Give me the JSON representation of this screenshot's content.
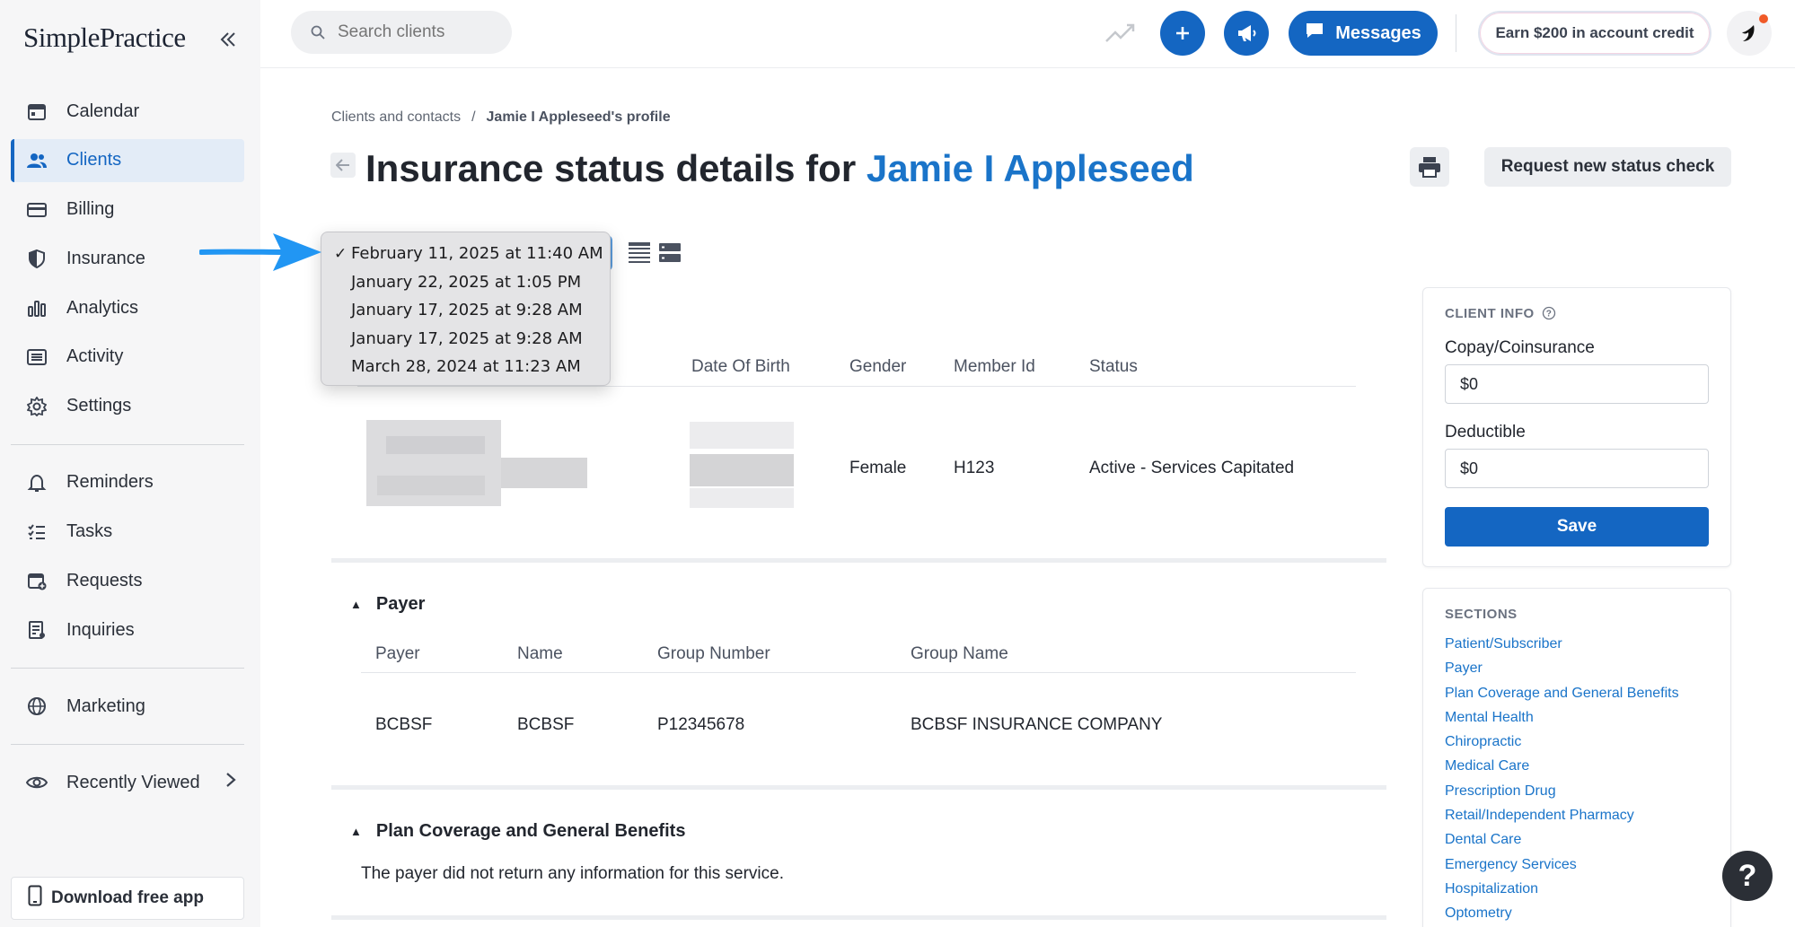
{
  "app": {
    "logo": "SimplePractice"
  },
  "sidebar": {
    "items": [
      {
        "label": "Calendar",
        "icon": "calendar-icon"
      },
      {
        "label": "Clients",
        "icon": "users-icon",
        "active": true
      },
      {
        "label": "Billing",
        "icon": "credit-card-icon"
      },
      {
        "label": "Insurance",
        "icon": "shield-icon"
      },
      {
        "label": "Analytics",
        "icon": "bar-chart-icon"
      },
      {
        "label": "Activity",
        "icon": "list-icon"
      },
      {
        "label": "Settings",
        "icon": "gear-icon"
      },
      {
        "label": "Reminders",
        "icon": "bell-icon"
      },
      {
        "label": "Tasks",
        "icon": "checklist-icon"
      },
      {
        "label": "Requests",
        "icon": "calendar-plus-icon"
      },
      {
        "label": "Inquiries",
        "icon": "document-icon"
      },
      {
        "label": "Marketing",
        "icon": "globe-icon"
      },
      {
        "label": "Recently Viewed",
        "icon": "eye-icon"
      }
    ],
    "download_app": "Download free app"
  },
  "topbar": {
    "search_placeholder": "Search clients",
    "messages_label": "Messages",
    "credit_label": "Earn $200 in account credit"
  },
  "breadcrumb": {
    "parent": "Clients and contacts",
    "separator": "/",
    "current": "Jamie I Appleseed's profile"
  },
  "page": {
    "title_prefix": "Insurance status details for",
    "client_name": "Jamie I Appleseed",
    "request_button": "Request new status check"
  },
  "status_dates": {
    "selected": "February 11, 2025 at 11:40 AM",
    "options": [
      "February 11, 2025 at 11:40 AM",
      "January 22, 2025 at 1:05 PM",
      "January 17, 2025 at 9:28 AM",
      "January 17, 2025 at 9:28 AM",
      "March 28, 2024 at 11:23 AM"
    ]
  },
  "patient_table": {
    "headers": [
      "Date Of Birth",
      "Gender",
      "Member Id",
      "Status"
    ],
    "row": {
      "gender": "Female",
      "member_id": "H123",
      "status": "Active - Services Capitated"
    }
  },
  "payer_section": {
    "title": "Payer",
    "headers": [
      "Payer",
      "Name",
      "Group Number",
      "Group Name"
    ],
    "row": [
      "BCBSF",
      "BCBSF",
      "P12345678",
      "BCBSF INSURANCE COMPANY"
    ]
  },
  "plan_section": {
    "title": "Plan Coverage and General Benefits",
    "message": "The payer did not return any information for this service."
  },
  "client_info": {
    "title": "CLIENT INFO",
    "copay_label": "Copay/Coinsurance",
    "copay_value": "$0",
    "deductible_label": "Deductible",
    "deductible_value": "$0",
    "save_label": "Save"
  },
  "sections_card": {
    "title": "SECTIONS",
    "links": [
      "Patient/Subscriber",
      "Payer",
      "Plan Coverage and General Benefits",
      "Mental Health",
      "Chiropractic",
      "Medical Care",
      "Prescription Drug",
      "Retail/Independent Pharmacy",
      "Dental Care",
      "Emergency Services",
      "Hospitalization",
      "Optometry"
    ]
  },
  "colors": {
    "brand_blue": "#1466c2",
    "annotation_arrow": "#2196f3"
  }
}
